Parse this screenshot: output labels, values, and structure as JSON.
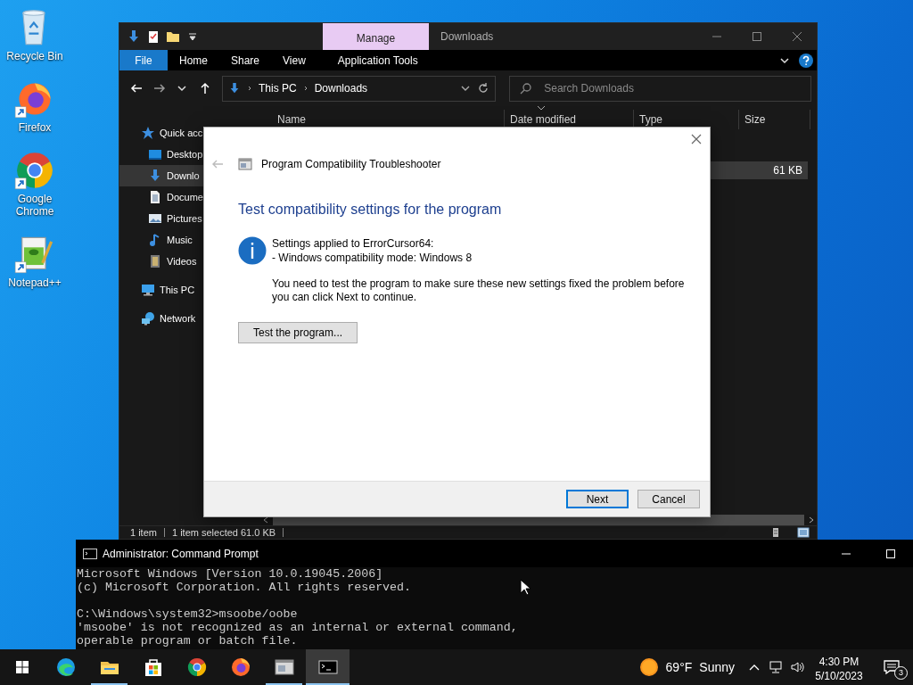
{
  "desktop_icons": [
    {
      "label": "Recycle Bin",
      "kind": "recycle",
      "shortcut": false
    },
    {
      "label": "Firefox",
      "kind": "firefox",
      "shortcut": true
    },
    {
      "label": "Google Chrome",
      "kind": "chrome",
      "shortcut": true
    },
    {
      "label": "Notepad++",
      "kind": "notepad",
      "shortcut": true
    }
  ],
  "explorer": {
    "title": "Downloads",
    "context_tab": "Manage",
    "file_tab": "File",
    "ribbon_tabs": [
      "Home",
      "Share",
      "View",
      "Application Tools"
    ],
    "path": [
      "This PC",
      "Downloads"
    ],
    "search": {
      "placeholder": "Search Downloads"
    },
    "nav": [
      {
        "label": "Quick acc",
        "kind": "star",
        "selected": false,
        "children": [
          {
            "label": "Desktop",
            "kind": "desktop",
            "selected": false
          },
          {
            "label": "Downlo",
            "kind": "download",
            "selected": true
          },
          {
            "label": "Docume",
            "kind": "document",
            "selected": false
          },
          {
            "label": "Pictures",
            "kind": "pictures",
            "selected": false
          },
          {
            "label": "Music",
            "kind": "music",
            "selected": false
          },
          {
            "label": "Videos",
            "kind": "videos",
            "selected": false
          }
        ]
      },
      {
        "label": "This PC",
        "kind": "pc",
        "selected": false
      },
      {
        "label": "Network",
        "kind": "network",
        "selected": false
      }
    ],
    "columns": [
      "Name",
      "Date modified",
      "Type",
      "Size"
    ],
    "rows": [
      {
        "size": "61 KB",
        "selected": true
      }
    ],
    "status_bar": [
      "1 item",
      "1 item selected 61.0 KB"
    ]
  },
  "dialog": {
    "title": "Program Compatibility Troubleshooter",
    "heading": "Test compatibility settings for the program",
    "info_lines": [
      "Settings applied to ErrorCursor64:",
      "- Windows compatibility mode: Windows 8"
    ],
    "message": "You need to test the program to make sure these new settings fixed the problem before you can click Next to continue.",
    "test_button": "Test the program...",
    "buttons": [
      {
        "label": "Next",
        "default": true
      },
      {
        "label": "Cancel",
        "default": false
      }
    ]
  },
  "console": {
    "title": "Administrator: Command Prompt",
    "blocks": [
      [
        "Microsoft Windows [Version 10.0.19045.2006]",
        "(c) Microsoft Corporation. All rights reserved."
      ],
      [
        "C:\\Windows\\system32>msoobe/oobe",
        "'msoobe' is not recognized as an internal or external command,",
        "operable program or batch file."
      ]
    ]
  },
  "taskbar": {
    "apps": [
      {
        "kind": "edge",
        "running": false,
        "active": false
      },
      {
        "kind": "explorer",
        "running": true,
        "active": false
      },
      {
        "kind": "store",
        "running": false,
        "active": false
      },
      {
        "kind": "chrome",
        "running": false,
        "active": false
      },
      {
        "kind": "firefox",
        "running": false,
        "active": false
      },
      {
        "kind": "troubleshooter",
        "running": true,
        "active": false
      },
      {
        "kind": "console",
        "running": true,
        "active": true
      }
    ],
    "weather": {
      "temperature": "69°F",
      "condition": "Sunny"
    },
    "clock": {
      "time": "4:30 PM",
      "date": "5/10/2023"
    },
    "notifications": {
      "count": "3"
    }
  }
}
